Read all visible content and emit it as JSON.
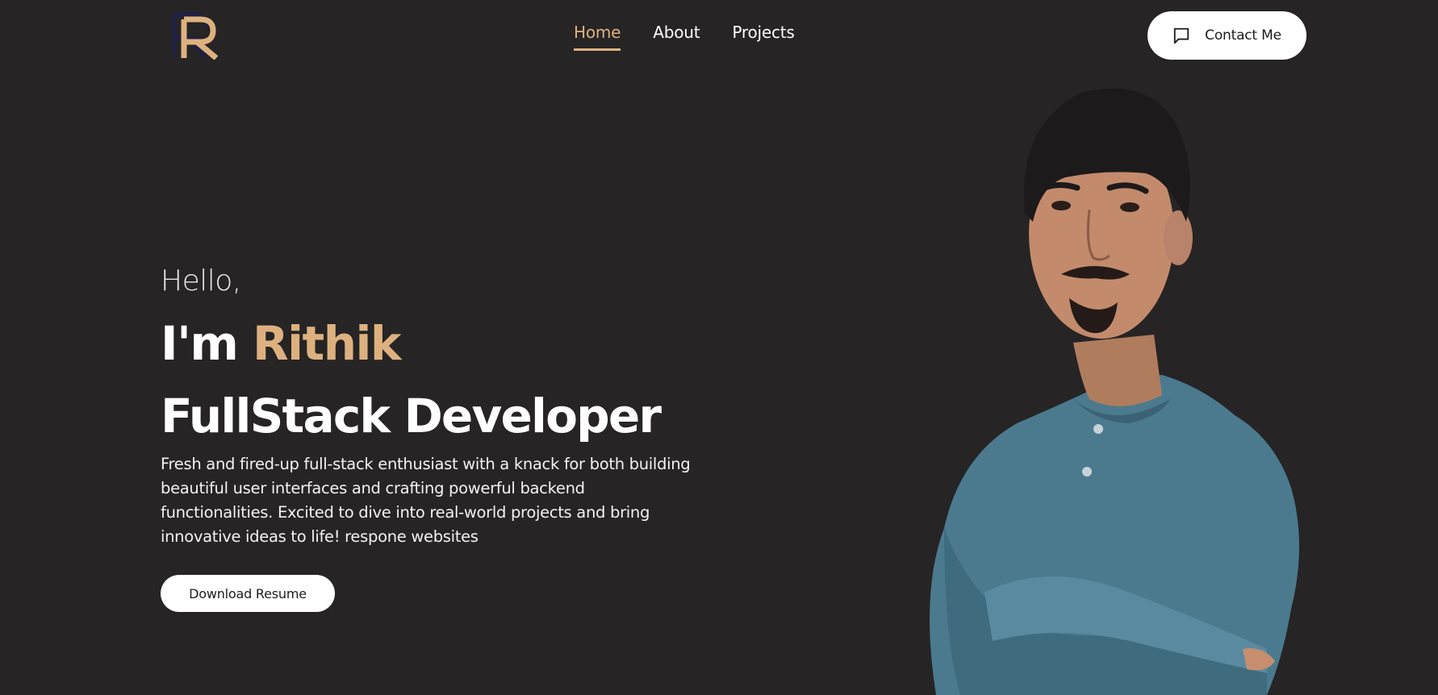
{
  "header": {
    "logo_letter": "R",
    "nav": [
      {
        "label": "Home",
        "active": true
      },
      {
        "label": "About",
        "active": false
      },
      {
        "label": "Projects",
        "active": false
      }
    ],
    "contact_label": "Contact Me",
    "contact_icon": "message-square-icon"
  },
  "hero": {
    "greeting": "Hello,",
    "intro_prefix": "I'm ",
    "name": "Rithik",
    "role": "FullStack Developer",
    "description": "Fresh and fired-up full-stack enthusiast with a knack for both building beautiful user interfaces and crafting powerful backend functionalities. Excited to dive into real-world projects and bring innovative ideas to life! respone websites",
    "resume_label": "Download Resume"
  },
  "colors": {
    "background": "#262425",
    "accent": "#DDB17F",
    "text": "#FFFFFF",
    "button_bg": "#FFFFFF"
  }
}
